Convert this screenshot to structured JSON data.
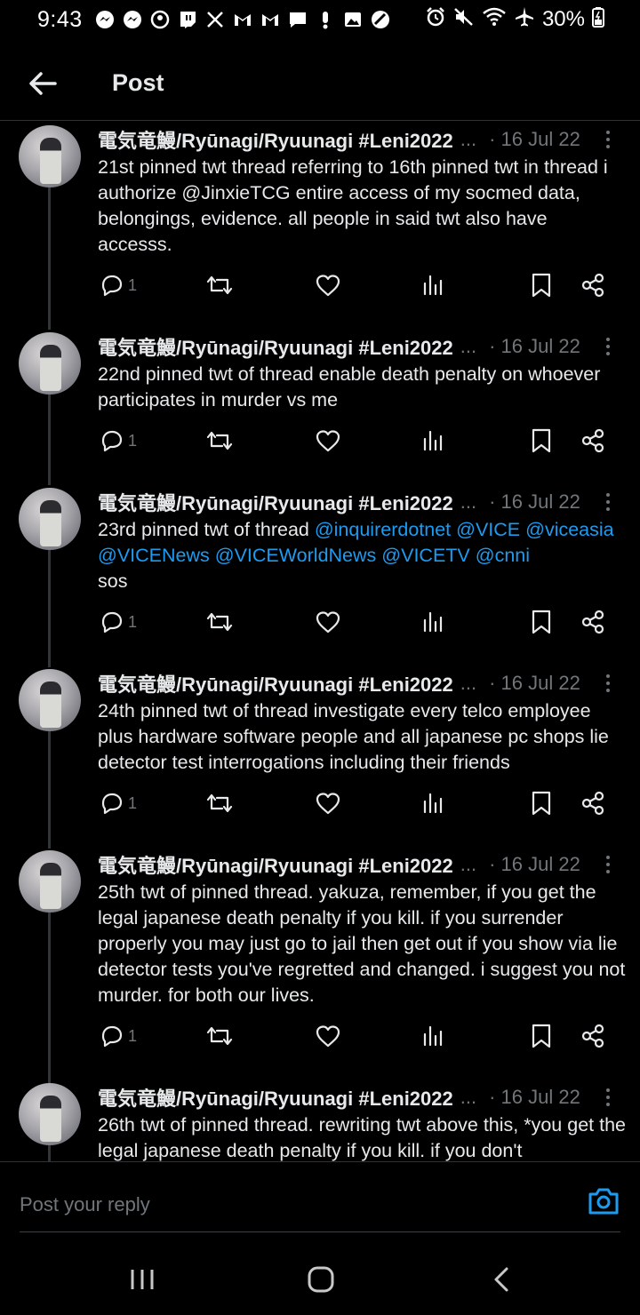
{
  "status_bar": {
    "time": "9:43",
    "battery": "30%",
    "left_icons": [
      "messenger-icon",
      "messenger-icon",
      "account-icon",
      "twitch-icon",
      "x-icon",
      "gmail-icon",
      "gmail-icon",
      "chat-icon",
      "alert-icon",
      "gallery-icon",
      "blocked-icon"
    ],
    "right_icons": [
      "alarm-icon",
      "mute-icon",
      "wifi-icon",
      "airplane-icon",
      "battery-charging-icon"
    ]
  },
  "header": {
    "title": "Post"
  },
  "tweets": [
    {
      "author": "電気竜鰻/Ryūnagi/Ryuunagi #Leni2022",
      "ellipsis": "...",
      "date": "· 16 Jul 22",
      "text": "21st pinned twt thread referring to 16th pinned twt in thread i authorize @JinxieTCG entire access of my socmed data, belongings, evidence. all people in said twt also have accesss.",
      "reply_count": "1"
    },
    {
      "author": "電気竜鰻/Ryūnagi/Ryuunagi #Leni2022",
      "ellipsis": "...",
      "date": "· 16 Jul 22",
      "text": "22nd pinned twt of thread enable death penalty on whoever participates in murder vs me",
      "reply_count": "1"
    },
    {
      "author": "電気竜鰻/Ryūnagi/Ryuunagi #Leni2022",
      "ellipsis": "...",
      "date": "· 16 Jul 22",
      "text_prefix": "23rd pinned twt of thread ",
      "mentions": [
        "@inquirerdotnet",
        "@VICE",
        "@viceasia",
        "@VICENews",
        "@VICEWorldNews",
        "@VICETV",
        "@cnni"
      ],
      "text_suffix": "sos",
      "reply_count": "1"
    },
    {
      "author": "電気竜鰻/Ryūnagi/Ryuunagi #Leni2022",
      "ellipsis": "...",
      "date": "· 16 Jul 22",
      "text": "24th pinned twt of thread investigate every telco employee plus hardware software people and all japanese pc shops lie detector test interrogations including their friends",
      "reply_count": "1"
    },
    {
      "author": "電気竜鰻/Ryūnagi/Ryuunagi #Leni2022",
      "ellipsis": "...",
      "date": "· 16 Jul 22",
      "text": "25th twt of pinned thread. yakuza, remember, if you get the legal japanese death penalty if you kill. if you surrender properly you may just go to jail then get out if you show via lie detector tests you've regretted and changed. i suggest you not murder. for both our lives.",
      "reply_count": "1"
    },
    {
      "author": "電気竜鰻/Ryūnagi/Ryuunagi #Leni2022",
      "ellipsis": "...",
      "date": "· 16 Jul 22",
      "text": "26th twt of pinned thread. rewriting twt above this, *you get the legal japanese death penalty if you kill. if you don't",
      "reply_count": ""
    }
  ],
  "reply_box": {
    "placeholder": "Post your reply"
  },
  "colors": {
    "background": "#000000",
    "text": "#e7e9ea",
    "muted": "#71767b",
    "accent": "#1d9bf0",
    "divider": "#2f3336"
  }
}
